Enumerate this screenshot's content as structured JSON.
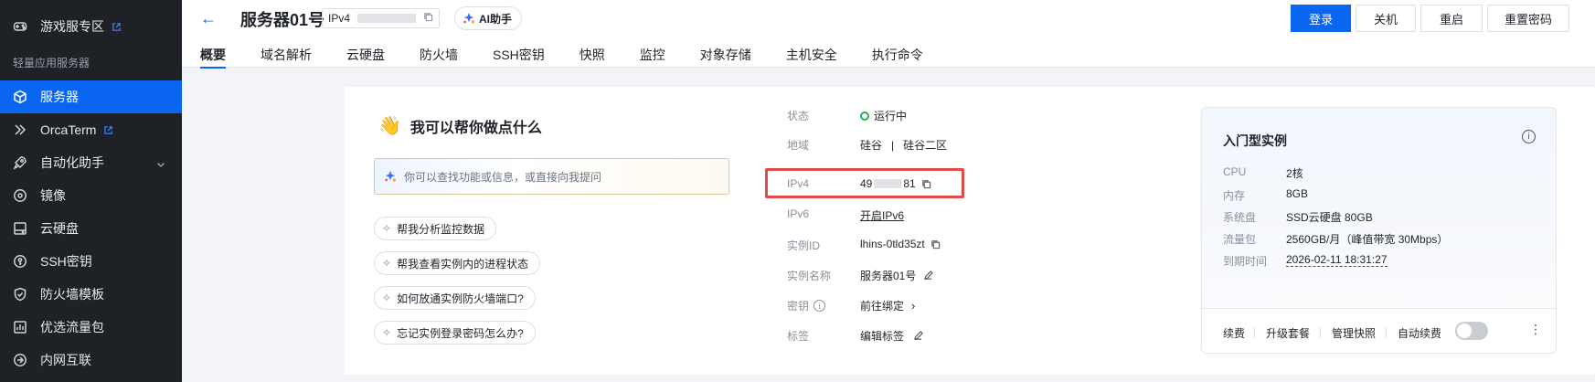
{
  "sidebar": {
    "items": [
      {
        "label": "游戏服专区",
        "icon": "gamepad-icon",
        "external": true
      },
      {
        "label": "服务器",
        "icon": "cube-icon",
        "active": true
      },
      {
        "label": "OrcaTerm",
        "icon": "terminal-icon",
        "external": true
      },
      {
        "label": "自动化助手",
        "icon": "rocket-icon",
        "expandable": true
      },
      {
        "label": "镜像",
        "icon": "disc-icon"
      },
      {
        "label": "云硬盘",
        "icon": "disk-icon"
      },
      {
        "label": "SSH密钥",
        "icon": "key-icon"
      },
      {
        "label": "防火墙模板",
        "icon": "shield-icon"
      },
      {
        "label": "优选流量包",
        "icon": "package-icon"
      },
      {
        "label": "内网互联",
        "icon": "network-icon"
      }
    ],
    "group_label": "轻量应用服务器"
  },
  "header": {
    "title": "服务器01号",
    "ip_type": "IPv4",
    "ai_label": "AI助手",
    "buttons": [
      "登录",
      "关机",
      "重启",
      "重置密码"
    ],
    "tabs": [
      "概要",
      "域名解析",
      "云硬盘",
      "防火墙",
      "SSH密钥",
      "快照",
      "监控",
      "对象存储",
      "主机安全",
      "执行命令"
    ]
  },
  "helper": {
    "title": "我可以帮你做点什么",
    "placeholder": "你可以查找功能或信息，或直接向我提问",
    "suggestions": [
      "帮我分析监控数据",
      "帮我查看实例内的进程状态",
      "如何放通实例防火墙端口?",
      "忘记实例登录密码怎么办?"
    ]
  },
  "info": {
    "status_label": "状态",
    "status_value": "运行中",
    "region_label": "地域",
    "region_value": "硅谷",
    "zone_value": "硅谷二区",
    "ipv4_label": "IPv4",
    "ipv4_prefix": "49",
    "ipv4_suffix": "81",
    "ipv6_label": "IPv6",
    "ipv6_value": "开启IPv6",
    "id_label": "实例ID",
    "id_value": "lhins-0tld35zt",
    "name_label": "实例名称",
    "name_value": "服务器01号",
    "key_label": "密钥",
    "key_value": "前往绑定",
    "tag_label": "标签",
    "tag_value": "编辑标签"
  },
  "instance": {
    "title": "入门型实例",
    "specs": [
      {
        "label": "CPU",
        "value": "2核"
      },
      {
        "label": "内存",
        "value": "8GB"
      },
      {
        "label": "系统盘",
        "value": "SSD云硬盘 80GB"
      },
      {
        "label": "流量包",
        "value": "2560GB/月（峰值带宽 30Mbps）"
      },
      {
        "label": "到期时间",
        "value": "2026-02-11 18:31:27"
      }
    ],
    "footer": [
      "续费",
      "升级套餐",
      "管理快照",
      "自动续费"
    ],
    "auto_renew": false
  },
  "colors": {
    "primary": "#0a65f0",
    "sidebar_bg": "#1e2126",
    "highlight": "#e04a48",
    "status_ok": "#1fb35b"
  }
}
